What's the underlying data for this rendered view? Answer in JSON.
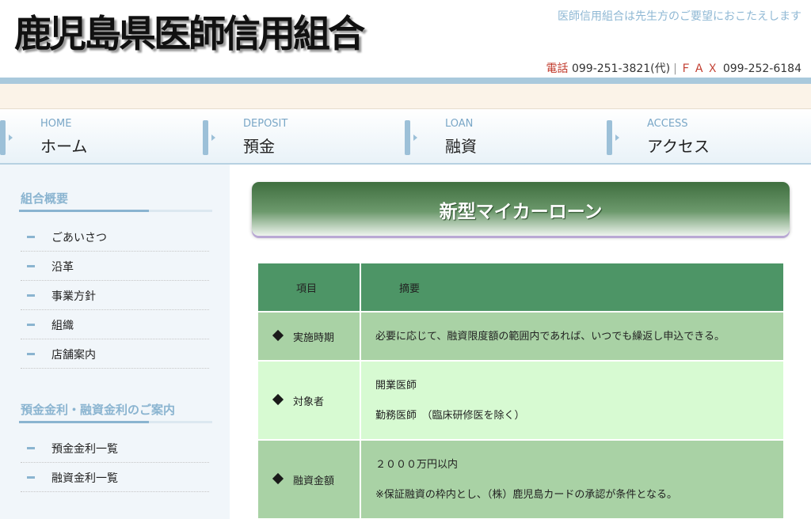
{
  "header": {
    "logo": "鹿児島県医師信用組合",
    "tagline": "医師信用組合は先生方のご要望におこたえします",
    "phone_label": "電話",
    "phone": "099-251-3821(代)",
    "fax_label": "ＦＡＸ",
    "fax": "099-252-6184"
  },
  "nav": [
    {
      "en": "HOME",
      "ja": "ホーム"
    },
    {
      "en": "DEPOSIT",
      "ja": "預金"
    },
    {
      "en": "LOAN",
      "ja": "融資"
    },
    {
      "en": "ACCESS",
      "ja": "アクセス"
    }
  ],
  "sidebar": {
    "section1": {
      "heading": "組合概要",
      "items": [
        "ごあいさつ",
        "沿革",
        "事業方針",
        "組織",
        "店舗案内"
      ]
    },
    "section2": {
      "heading": "預金金利・融資金利のご案内",
      "items": [
        "預金金利一覧",
        "融資金利一覧"
      ]
    }
  },
  "main": {
    "title": "新型マイカーローン",
    "table": {
      "headers": [
        "項目",
        "摘要"
      ],
      "rows": [
        {
          "label": "実施時期",
          "lines": [
            "必要に応じて、融資限度額の範囲内であれば、いつでも繰返し申込できる。"
          ]
        },
        {
          "label": "対象者",
          "lines": [
            "開業医師",
            "勤務医師　（臨床研修医を除く）"
          ]
        },
        {
          "label": "融資金額",
          "lines": [
            "２０００万円以内",
            "※保証融資の枠内とし、（株）鹿児島カードの承認が条件となる。"
          ]
        }
      ]
    }
  },
  "colors": {
    "accent_blue": "#8ab4d0",
    "table_header_green": "#4d9566",
    "row_dark_green": "#a9d2a5",
    "row_light_green": "#d7fad2",
    "contact_red": "#c0392b"
  }
}
